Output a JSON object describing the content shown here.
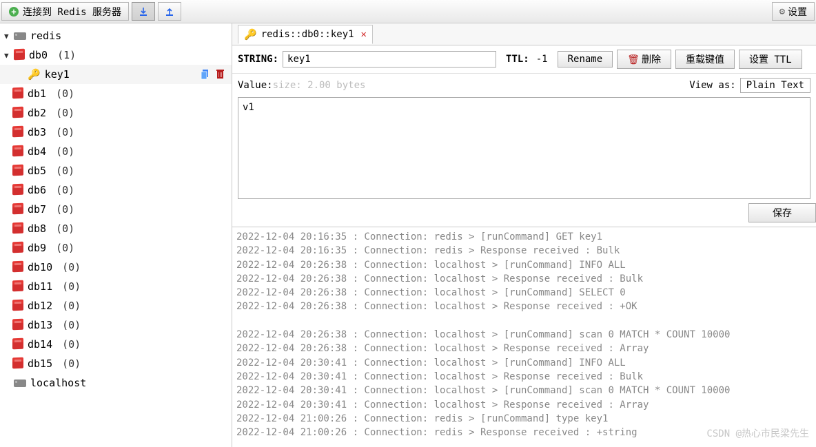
{
  "toolbar": {
    "connect_label": "连接到 Redis 服务器",
    "settings_label": "设置"
  },
  "tree": {
    "server1": "redis",
    "server2": "localhost",
    "db_expanded": {
      "name": "db0",
      "count": "(1)"
    },
    "selected_key": "key1",
    "dbs": [
      {
        "name": "db1",
        "count": "(0)"
      },
      {
        "name": "db2",
        "count": "(0)"
      },
      {
        "name": "db3",
        "count": "(0)"
      },
      {
        "name": "db4",
        "count": "(0)"
      },
      {
        "name": "db5",
        "count": "(0)"
      },
      {
        "name": "db6",
        "count": "(0)"
      },
      {
        "name": "db7",
        "count": "(0)"
      },
      {
        "name": "db8",
        "count": "(0)"
      },
      {
        "name": "db9",
        "count": "(0)"
      },
      {
        "name": "db10",
        "count": "(0)"
      },
      {
        "name": "db11",
        "count": "(0)"
      },
      {
        "name": "db12",
        "count": "(0)"
      },
      {
        "name": "db13",
        "count": "(0)"
      },
      {
        "name": "db14",
        "count": "(0)"
      },
      {
        "name": "db15",
        "count": "(0)"
      }
    ]
  },
  "tab": {
    "title": "redis::db0::key1"
  },
  "key": {
    "type_label": "STRING:",
    "name": "key1",
    "ttl_label": "TTL:",
    "ttl_value": "-1",
    "rename_label": "Rename",
    "delete_label": "删除",
    "reload_label": "重载键值",
    "set_ttl_label": "设置 TTL"
  },
  "value": {
    "label": "Value: ",
    "size": "size: 2.00 bytes",
    "view_as_label": "View as:",
    "view_as_value": "Plain Text",
    "content": "v1",
    "save_label": "保存"
  },
  "log": {
    "lines": [
      "2022-12-04 20:16:35 : Connection: redis > [runCommand] GET key1",
      "2022-12-04 20:16:35 : Connection: redis > Response received : Bulk",
      "2022-12-04 20:26:38 : Connection: localhost > [runCommand] INFO ALL",
      "2022-12-04 20:26:38 : Connection: localhost > Response received : Bulk",
      "2022-12-04 20:26:38 : Connection: localhost > [runCommand] SELECT 0",
      "2022-12-04 20:26:38 : Connection: localhost > Response received : +OK",
      "",
      "2022-12-04 20:26:38 : Connection: localhost > [runCommand] scan 0 MATCH * COUNT 10000",
      "2022-12-04 20:26:38 : Connection: localhost > Response received : Array",
      "2022-12-04 20:30:41 : Connection: localhost > [runCommand] INFO ALL",
      "2022-12-04 20:30:41 : Connection: localhost > Response received : Bulk",
      "2022-12-04 20:30:41 : Connection: localhost > [runCommand] scan 0 MATCH * COUNT 10000",
      "2022-12-04 20:30:41 : Connection: localhost > Response received : Array",
      "2022-12-04 21:00:26 : Connection: redis > [runCommand] type key1",
      "2022-12-04 21:00:26 : Connection: redis > Response received : +string"
    ]
  },
  "watermark": "CSDN @热心市民梁先生"
}
